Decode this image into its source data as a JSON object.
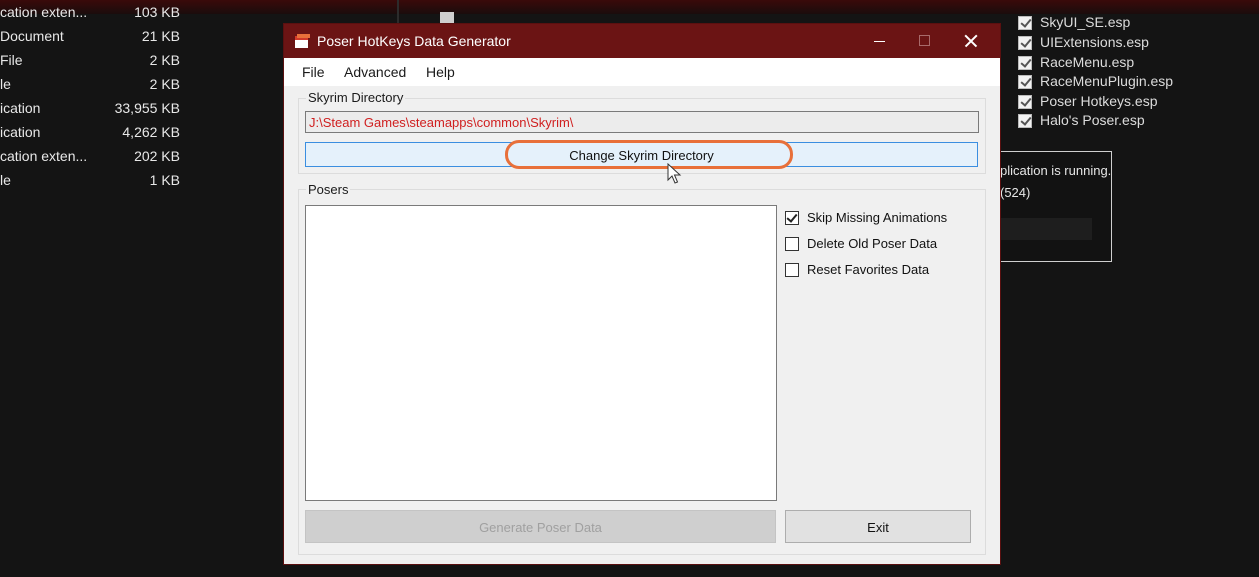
{
  "background": {
    "files": [
      {
        "name": "cation exten...",
        "size": "103 KB"
      },
      {
        "name": "Document",
        "size": "21 KB"
      },
      {
        "name": "File",
        "size": "2 KB"
      },
      {
        "name": "le",
        "size": "2 KB"
      },
      {
        "name": "ication",
        "size": "33,955 KB"
      },
      {
        "name": "ication",
        "size": "4,262 KB"
      },
      {
        "name": "cation exten...",
        "size": "202 KB"
      },
      {
        "name": "le",
        "size": "1 KB"
      }
    ],
    "plugins": [
      "SkyUI_SE.esp",
      "UIExtensions.esp",
      "RaceMenu.esp",
      "RaceMenuPlugin.esp",
      "Poser Hotkeys.esp",
      "Halo's Poser.esp"
    ],
    "console": {
      "line1": "plication is running.",
      "line2": "(524)"
    }
  },
  "dialog": {
    "title": "Poser HotKeys Data Generator",
    "menu": [
      "File",
      "Advanced",
      "Help"
    ],
    "skyrim_group_label": "Skyrim Directory",
    "directory_value": "J:\\Steam Games\\steamapps\\common\\Skyrim\\",
    "change_button": "Change Skyrim Directory",
    "posers_group_label": "Posers",
    "options": [
      {
        "label": "Skip Missing Animations",
        "checked": true
      },
      {
        "label": "Delete Old Poser Data",
        "checked": false
      },
      {
        "label": "Reset Favorites Data",
        "checked": false
      }
    ],
    "generate_button": "Generate Poser Data",
    "exit_button": "Exit"
  },
  "colors": {
    "titlebar": "#6b1414",
    "path_text": "#d02020",
    "highlight": "#e8703a"
  }
}
